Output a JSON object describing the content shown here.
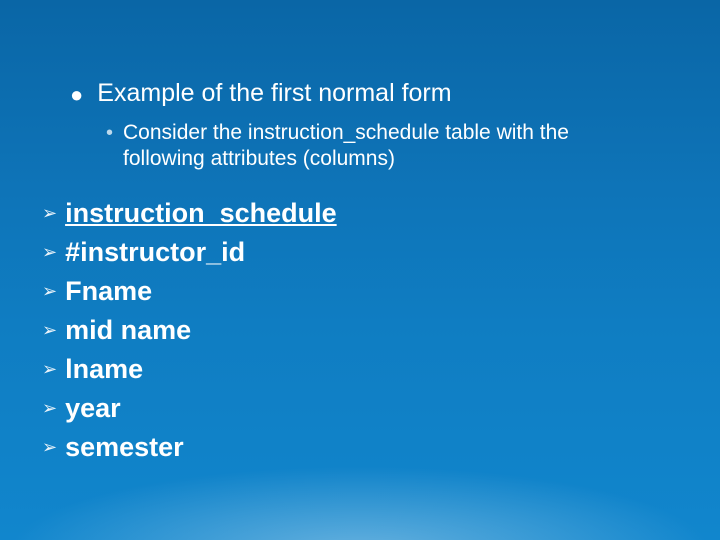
{
  "level1": {
    "text": "Example of the first normal form"
  },
  "level2": {
    "text": "Consider the instruction_schedule table with the following attributes (columns)"
  },
  "items": [
    {
      "text": "instruction_schedule",
      "underline": true
    },
    {
      "text": "#instructor_id",
      "underline": false
    },
    {
      "text": "Fname",
      "underline": false
    },
    {
      "text": "mid name",
      "underline": false
    },
    {
      "text": "lname",
      "underline": false
    },
    {
      "text": "year",
      "underline": false
    },
    {
      "text": "semester",
      "underline": false
    }
  ],
  "glyphs": {
    "dot": "●",
    "disc": "•",
    "arrow": "➢"
  }
}
